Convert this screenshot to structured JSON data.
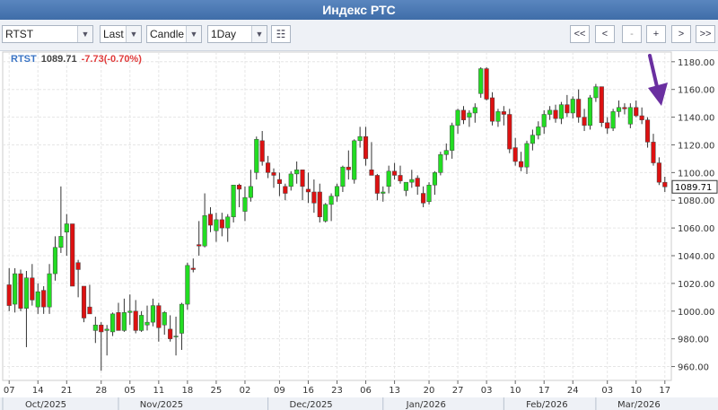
{
  "title": "Индекс РТС",
  "toolbar": {
    "symbol": "RTST",
    "price_field": "Last",
    "chart_style": "Candle",
    "interval": "1Day",
    "config_icon": "table-config-icon",
    "nav": [
      "<<",
      "<",
      "-",
      "+",
      ">",
      ">>"
    ]
  },
  "readout": {
    "symbol": "RTST",
    "last": "1089.71",
    "change": "-7.73(-0.70%)"
  },
  "colors": {
    "up": "#22dd22",
    "down": "#dd1111",
    "wick": "#333333",
    "arrow": "#6a2fa0",
    "grid": "#e6e6e6"
  },
  "annotation": {
    "type": "arrow",
    "color": "#6a2fa0",
    "direction": "down"
  },
  "chart_data": {
    "type": "candlestick",
    "ylim": [
      950,
      1187
    ],
    "yticks": [
      "1180.00",
      "1160.00",
      "1140.00",
      "1120.00",
      "1100.00",
      "1080.00",
      "1060.00",
      "1040.00",
      "1020.00",
      "1000.00",
      "980.00",
      "960.00"
    ],
    "last_label": "1089.71",
    "xticks": [
      "07",
      "14",
      "21",
      "28",
      "05",
      "11",
      "18",
      "25",
      "02",
      "09",
      "16",
      "23",
      "06",
      "13",
      "20",
      "27",
      "03",
      "10",
      "17",
      "24",
      "03",
      "10",
      "17"
    ],
    "months": [
      "Oct/2025",
      "Nov/2025",
      "Dec/2025",
      "Jan/2026",
      "Feb/2026",
      "Mar/2026"
    ],
    "candles": [
      [
        1019,
        1031,
        1000,
        1004
      ],
      [
        1005,
        1031,
        999,
        1027
      ],
      [
        1027,
        1030,
        1000,
        1002
      ],
      [
        1002,
        1029,
        974,
        1024
      ],
      [
        1024,
        1034,
        1004,
        1008
      ],
      [
        1003,
        1020,
        998,
        1014
      ],
      [
        1015,
        1018,
        998,
        1003
      ],
      [
        1003,
        1034,
        998,
        1027
      ],
      [
        1027,
        1054,
        1022,
        1046
      ],
      [
        1046,
        1090,
        1042,
        1054
      ],
      [
        1057,
        1070,
        1040,
        1063
      ],
      [
        1063,
        1063,
        1018,
        1018
      ],
      [
        1035,
        1037,
        1010,
        1030
      ],
      [
        1018,
        1018,
        992,
        995
      ],
      [
        1003,
        1019,
        1000,
        998
      ],
      [
        986,
        996,
        977,
        990
      ],
      [
        990,
        992,
        957,
        985
      ],
      [
        986,
        990,
        968,
        987
      ],
      [
        985,
        999,
        982,
        998
      ],
      [
        999,
        1006,
        995,
        986
      ],
      [
        986,
        1009,
        985,
        999
      ],
      [
        999,
        1012,
        990,
        1000
      ],
      [
        1000,
        1008,
        984,
        986
      ],
      [
        986,
        1000,
        985,
        997
      ],
      [
        990,
        1004,
        986,
        992
      ],
      [
        992,
        1009,
        989,
        1004
      ],
      [
        1004,
        1006,
        978,
        988
      ],
      [
        990,
        1000,
        983,
        999
      ],
      [
        987,
        997,
        978,
        980
      ],
      [
        982,
        996,
        968,
        982
      ],
      [
        984,
        1006,
        972,
        1005
      ],
      [
        1005,
        1035,
        1001,
        1033
      ],
      [
        1031,
        1038,
        1028,
        1030
      ],
      [
        1048,
        1065,
        1040,
        1047
      ],
      [
        1047,
        1085,
        1046,
        1069
      ],
      [
        1070,
        1075,
        1057,
        1062
      ],
      [
        1058,
        1071,
        1050,
        1066
      ],
      [
        1066,
        1071,
        1054,
        1060
      ],
      [
        1060,
        1070,
        1050,
        1068
      ],
      [
        1068,
        1082,
        1064,
        1091
      ],
      [
        1091,
        1092,
        1075,
        1088
      ],
      [
        1072,
        1090,
        1065,
        1082
      ],
      [
        1082,
        1102,
        1079,
        1090
      ],
      [
        1100,
        1126,
        1095,
        1124
      ],
      [
        1123,
        1130,
        1105,
        1108
      ],
      [
        1107,
        1112,
        1096,
        1100
      ],
      [
        1100,
        1103,
        1089,
        1098
      ],
      [
        1095,
        1100,
        1083,
        1092
      ],
      [
        1090,
        1092,
        1080,
        1085
      ],
      [
        1090,
        1101,
        1087,
        1099
      ],
      [
        1099,
        1108,
        1092,
        1102
      ],
      [
        1102,
        1102,
        1080,
        1090
      ],
      [
        1088,
        1100,
        1078,
        1086
      ],
      [
        1086,
        1095,
        1071,
        1078
      ],
      [
        1086,
        1092,
        1064,
        1068
      ],
      [
        1065,
        1078,
        1064,
        1077
      ],
      [
        1077,
        1085,
        1065,
        1083
      ],
      [
        1083,
        1092,
        1079,
        1090
      ],
      [
        1090,
        1105,
        1086,
        1104
      ],
      [
        1104,
        1116,
        1095,
        1102
      ],
      [
        1095,
        1124,
        1092,
        1123
      ],
      [
        1123,
        1133,
        1118,
        1126
      ],
      [
        1126,
        1133,
        1105,
        1110
      ],
      [
        1102,
        1122,
        1098,
        1098
      ],
      [
        1098,
        1099,
        1080,
        1085
      ],
      [
        1085,
        1090,
        1079,
        1086
      ],
      [
        1090,
        1105,
        1085,
        1101
      ],
      [
        1101,
        1107,
        1095,
        1098
      ],
      [
        1098,
        1105,
        1092,
        1094
      ],
      [
        1087,
        1093,
        1083,
        1093
      ],
      [
        1093,
        1102,
        1089,
        1095
      ],
      [
        1096,
        1098,
        1084,
        1090
      ],
      [
        1085,
        1090,
        1075,
        1078
      ],
      [
        1079,
        1093,
        1077,
        1091
      ],
      [
        1091,
        1101,
        1084,
        1100
      ],
      [
        1100,
        1115,
        1098,
        1113
      ],
      [
        1113,
        1121,
        1109,
        1116
      ],
      [
        1116,
        1136,
        1110,
        1134
      ],
      [
        1134,
        1146,
        1128,
        1145
      ],
      [
        1145,
        1148,
        1135,
        1138
      ],
      [
        1140,
        1145,
        1133,
        1143
      ],
      [
        1143,
        1150,
        1136,
        1147
      ],
      [
        1157,
        1176,
        1154,
        1175
      ],
      [
        1175,
        1176,
        1152,
        1153
      ],
      [
        1154,
        1158,
        1134,
        1137
      ],
      [
        1137,
        1146,
        1133,
        1144
      ],
      [
        1144,
        1148,
        1134,
        1142
      ],
      [
        1142,
        1146,
        1114,
        1117
      ],
      [
        1118,
        1125,
        1105,
        1108
      ],
      [
        1108,
        1115,
        1101,
        1104
      ],
      [
        1104,
        1123,
        1099,
        1121
      ],
      [
        1121,
        1131,
        1116,
        1127
      ],
      [
        1127,
        1137,
        1124,
        1133
      ],
      [
        1133,
        1145,
        1128,
        1142
      ],
      [
        1142,
        1148,
        1138,
        1145
      ],
      [
        1145,
        1149,
        1136,
        1139
      ],
      [
        1139,
        1151,
        1135,
        1149
      ],
      [
        1149,
        1156,
        1140,
        1143
      ],
      [
        1143,
        1155,
        1139,
        1153
      ],
      [
        1153,
        1160,
        1136,
        1140
      ],
      [
        1140,
        1146,
        1130,
        1134
      ],
      [
        1134,
        1156,
        1131,
        1154
      ],
      [
        1154,
        1164,
        1151,
        1162
      ],
      [
        1162,
        1162,
        1133,
        1136
      ],
      [
        1136,
        1140,
        1128,
        1132
      ],
      [
        1132,
        1146,
        1130,
        1144
      ],
      [
        1144,
        1152,
        1140,
        1147
      ],
      [
        1147,
        1150,
        1142,
        1146
      ],
      [
        1135,
        1150,
        1132,
        1147
      ],
      [
        1147,
        1152,
        1140,
        1141
      ],
      [
        1141,
        1147,
        1135,
        1138
      ],
      [
        1138,
        1140,
        1118,
        1122
      ],
      [
        1122,
        1128,
        1105,
        1107
      ],
      [
        1107,
        1111,
        1091,
        1093
      ],
      [
        1093,
        1097,
        1086,
        1089.71
      ]
    ]
  }
}
